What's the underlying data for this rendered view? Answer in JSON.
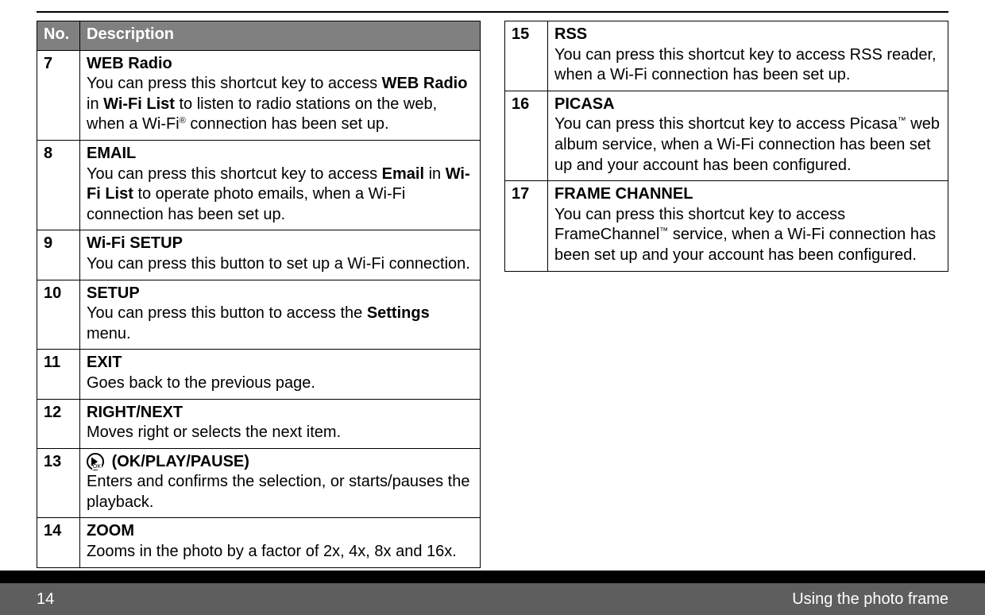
{
  "header": {
    "no": "No.",
    "desc": "Description"
  },
  "left": [
    {
      "no": "7",
      "title": "WEB Radio",
      "body_html": "You can press this shortcut key to access <span class='b'>WEB Radio</span> in <span class='b'>Wi-Fi List</span> to listen to radio stations on the web, when a Wi-Fi<sup>®</sup> connection has been set up."
    },
    {
      "no": "8",
      "title": "EMAIL",
      "body_html": "You can press this shortcut key to access <span class='b'>Email</span> in <span class='b'>Wi-Fi List</span> to operate photo emails, when a Wi-Fi connection has been set up."
    },
    {
      "no": "9",
      "title": "Wi-Fi SETUP",
      "body_html": "You can press this button to set up a Wi-Fi connection."
    },
    {
      "no": "10",
      "title": "SETUP",
      "body_html": "You can press this button to access the <span class='b'>Settings</span> menu."
    },
    {
      "no": "11",
      "title": "EXIT",
      "body_html": "Goes back to the previous page."
    },
    {
      "no": "12",
      "title": "RIGHT/NEXT",
      "body_html": "Moves right or selects the next item."
    },
    {
      "no": "13",
      "icon": true,
      "title": "(OK/PLAY/PAUSE)",
      "body_html": "Enters and confirms the selection, or starts/pauses the playback."
    },
    {
      "no": "14",
      "title": "ZOOM",
      "body_html": "Zooms in the photo by a factor of 2x, 4x, 8x and 16x."
    }
  ],
  "right": [
    {
      "no": "15",
      "title": "RSS",
      "body_html": "You can press this shortcut key to access RSS reader, when a Wi-Fi connection has been set up."
    },
    {
      "no": "16",
      "title": "PICASA",
      "body_html": "You can press this shortcut key to access Picasa<sup>™</sup> web album service, when a Wi-Fi connection has been set up and your account has been configured."
    },
    {
      "no": "17",
      "title": "FRAME CHANNEL",
      "body_html": "You can press this shortcut key to access FrameChannel<sup>™</sup> service, when a Wi-Fi connection has been set up and your account has been configured."
    }
  ],
  "footer": {
    "page": "14",
    "section": "Using the photo frame"
  }
}
